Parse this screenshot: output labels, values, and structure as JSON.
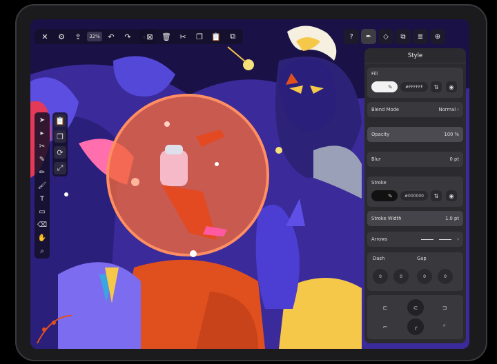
{
  "toolbar": {
    "zoom": "32%"
  },
  "panel": {
    "title": "Style",
    "fill": {
      "label": "Fill",
      "hex": "#FFFFFF"
    },
    "blend_mode": {
      "label": "Blend Mode",
      "value": "Normal"
    },
    "opacity": {
      "label": "Opacity",
      "value": "100 %"
    },
    "blur": {
      "label": "Blur",
      "value": "0 pt"
    },
    "stroke": {
      "label": "Stroke",
      "hex": "#000000"
    },
    "stroke_width": {
      "label": "Stroke Width",
      "value": "1.0 pt"
    },
    "arrows": {
      "label": "Arrows"
    },
    "dash": {
      "label": "Dash",
      "values": [
        "0",
        "0"
      ]
    },
    "gap": {
      "label": "Gap",
      "values": [
        "0",
        "0"
      ]
    }
  },
  "colors": {
    "panel_bg": "#2b2b2f",
    "section_bg": "#38383d",
    "canvas_bg": "#1a1146"
  }
}
